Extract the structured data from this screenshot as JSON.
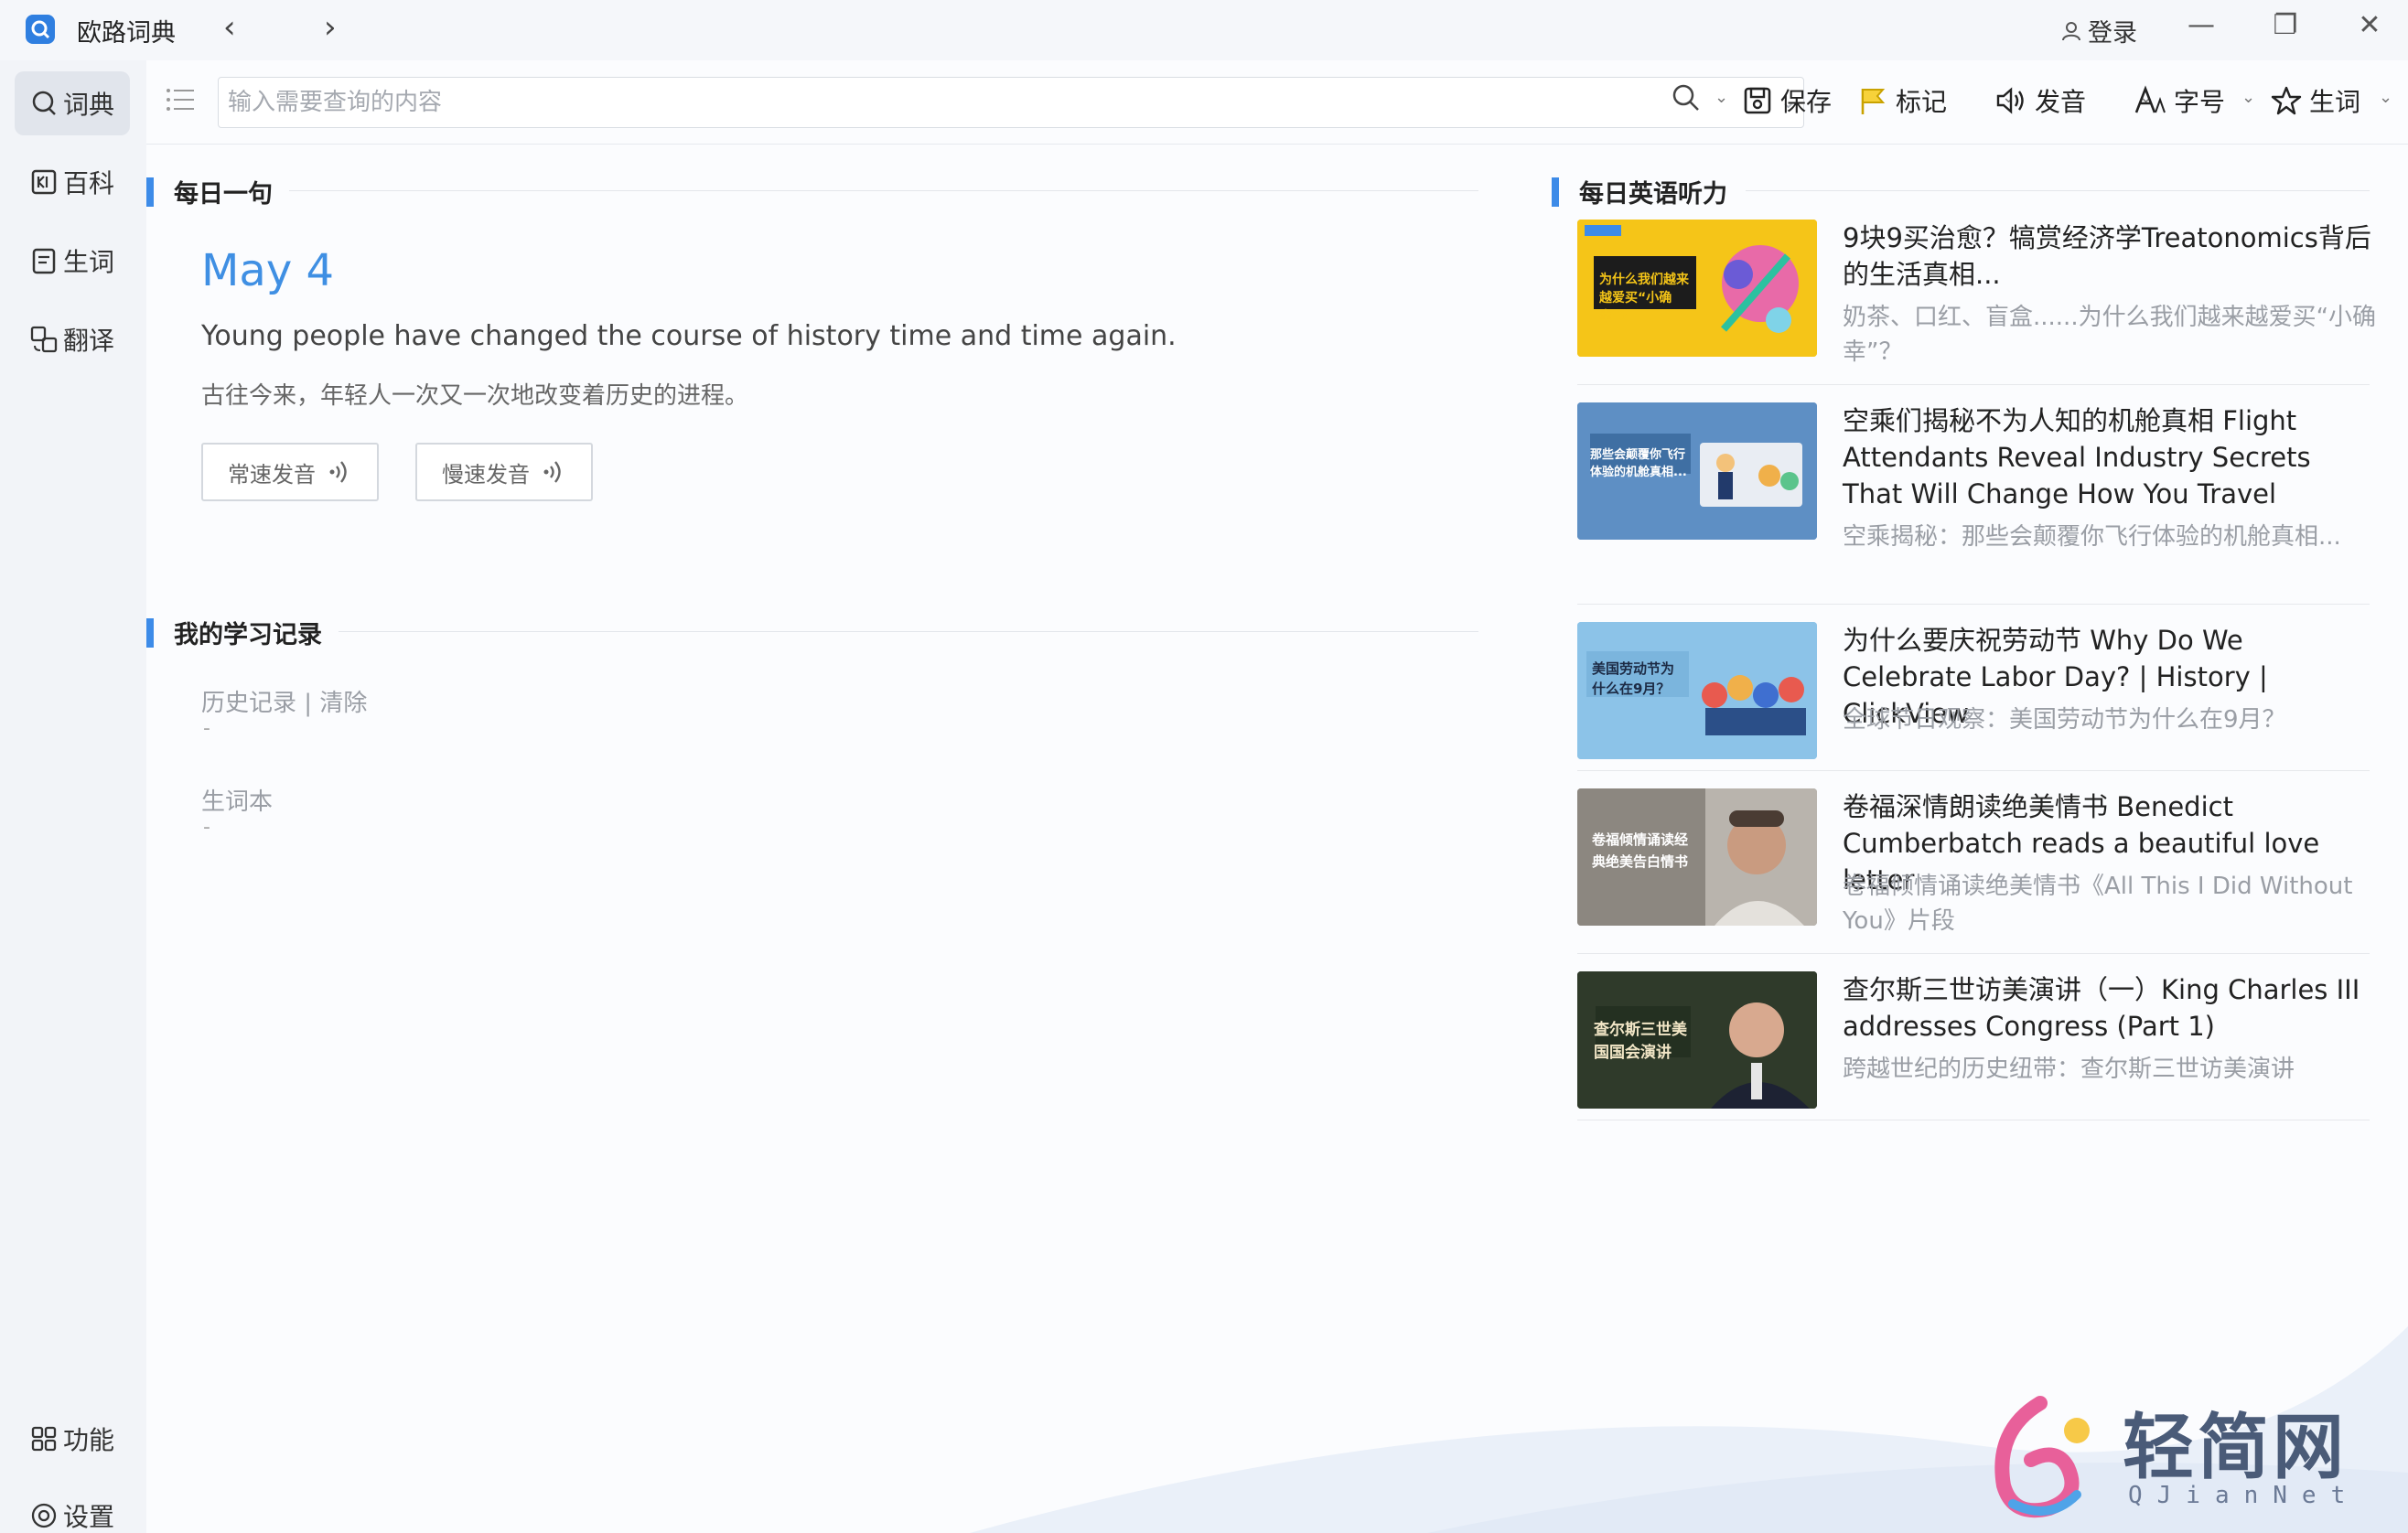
{
  "app": {
    "title": "欧路词典",
    "login_label": "登录"
  },
  "sidebar": {
    "items": [
      {
        "label": "词典",
        "icon": "dictionary-search-icon"
      },
      {
        "label": "百科",
        "icon": "encyclopedia-icon"
      },
      {
        "label": "生词",
        "icon": "wordbook-icon"
      },
      {
        "label": "翻译",
        "icon": "translate-icon"
      }
    ],
    "bottom": [
      {
        "label": "功能",
        "icon": "grid-apps-icon"
      },
      {
        "label": "设置",
        "icon": "gear-icon"
      }
    ]
  },
  "toolbar": {
    "search_placeholder": "输入需要查询的内容",
    "save_label": "保存",
    "mark_label": "标记",
    "pronounce_label": "发音",
    "fontsize_label": "字号",
    "newword_label": "生词"
  },
  "daily_sentence": {
    "section_title": "每日一句",
    "date": "May 4",
    "english": "Young people have changed the course of history time and time again.",
    "chinese": "古往今来，年轻人一次又一次地改变着历史的进程。",
    "normal_speed_label": "常速发音",
    "slow_speed_label": "慢速发音"
  },
  "study_record": {
    "section_title": "我的学习记录",
    "history_label": "历史记录",
    "separator": " | ",
    "clear_label": "清除",
    "history_value": "-",
    "wordbook_label": "生词本",
    "wordbook_value": "-"
  },
  "listening": {
    "section_title": "每日英语听力",
    "items": [
      {
        "title": "9块9买治愈？犒赏经济学Treatonomics背后的生活真相...",
        "desc": "奶茶、口红、盲盒......为什么我们越来越爱买“小确幸”？",
        "thumb_text": "为什么我们越来越爱买“小确幸”？",
        "thumb_color": "#f5c518"
      },
      {
        "title": "空乘们揭秘不为人知的机舱真相 Flight Attendants Reveal Industry Secrets That Will Change How You Travel",
        "desc": "空乘揭秘：那些会颠覆你飞行体验的机舱真相...",
        "thumb_text": "那些会颠覆你飞行体验的机舱真相...",
        "thumb_color": "#5e8fc4"
      },
      {
        "title": "为什么要庆祝劳动节 Why Do We Celebrate Labor Day? | History | ClickView",
        "desc": "全球节日观察：美国劳动节为什么在9月？",
        "thumb_text": "美国劳动节为什么在9月？",
        "thumb_color": "#8cc3e8"
      },
      {
        "title": "卷福深情朗读绝美情书 Benedict Cumberbatch reads a beautiful love letter",
        "desc": "卷福倾情诵读绝美情书《All This I Did Without You》片段",
        "thumb_text": "卷福倾情诵读经典绝美告白情书",
        "thumb_color": "#9a9690"
      },
      {
        "title": "查尔斯三世访美演讲（一）King Charles III addresses Congress (Part 1)",
        "desc": "跨越世纪的历史纽带：查尔斯三世访美演讲",
        "thumb_text": "查尔斯三世美国国会演讲",
        "thumb_color": "#2f3a2a"
      }
    ]
  },
  "watermark": {
    "text": "轻简网",
    "sub": "QJianNet"
  },
  "colors": {
    "accent": "#3d8be8",
    "date_blue": "#3f8fe3"
  }
}
